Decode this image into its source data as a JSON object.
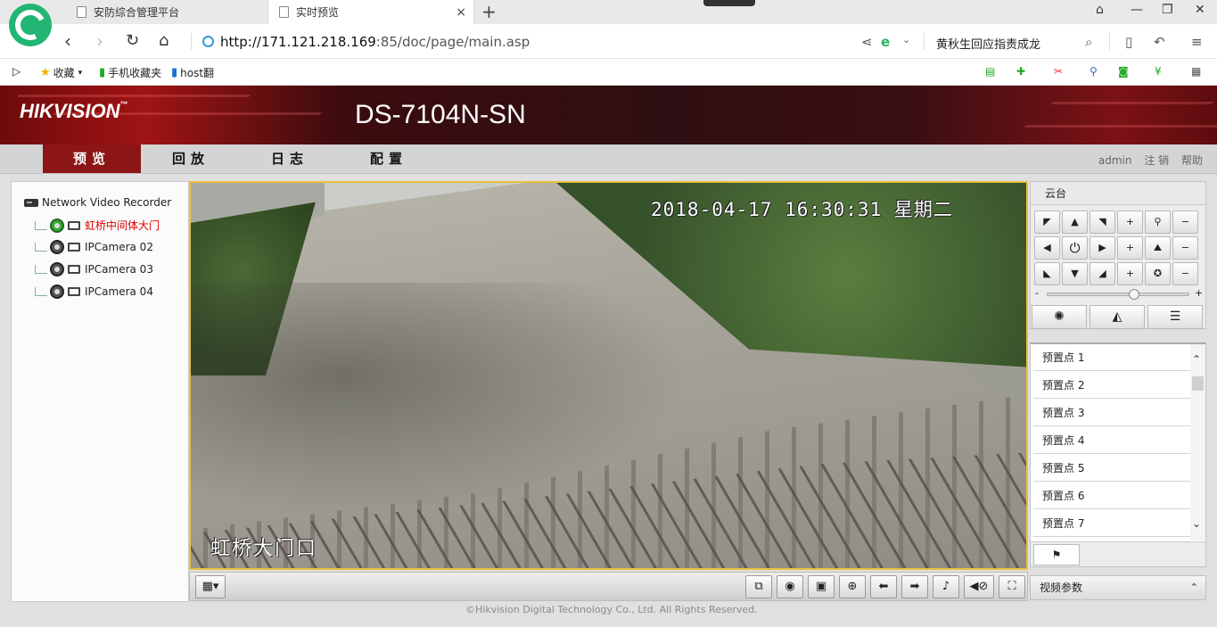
{
  "browser": {
    "tabs": [
      {
        "label": "安防综合管理平台"
      },
      {
        "label": "实时预览",
        "close": "×"
      }
    ],
    "new_tab": "+",
    "url_host": "http://171.121.218.169",
    "url_rest": ":85/doc/page/main.asp",
    "search_text": "黄秋生回应指责成龙",
    "favorites": [
      {
        "label": "收藏",
        "icon": "star-icon"
      },
      {
        "label": "手机收藏夹",
        "icon": "phone-icon"
      },
      {
        "label": "host翻",
        "icon": "bookmark-icon"
      }
    ]
  },
  "header": {
    "logo_text": "HIKVISION",
    "model": "DS-7104N-SN"
  },
  "menu": {
    "items": [
      {
        "label": "预览"
      },
      {
        "label": "回放"
      },
      {
        "label": "日志"
      },
      {
        "label": "配置"
      }
    ],
    "user": "admin",
    "logout": "注 销",
    "help": "帮助"
  },
  "tree": {
    "root": "Network Video Recorder",
    "cameras": [
      {
        "name": "虹桥中间体大门",
        "active": true
      },
      {
        "name": "IPCamera 02",
        "active": false
      },
      {
        "name": "IPCamera 03",
        "active": false
      },
      {
        "name": "IPCamera 04",
        "active": false
      }
    ]
  },
  "video": {
    "osd_time": "2018-04-17 16:30:31 星期二",
    "osd_name": "虹桥大门口"
  },
  "ptz": {
    "title": "云台",
    "presets": [
      "预置点 1",
      "预置点 2",
      "预置点 3",
      "预置点 4",
      "预置点 5",
      "预置点 6",
      "预置点 7"
    ],
    "video_params": "视频参数"
  },
  "footer": {
    "copyright": "©Hikvision Digital Technology Co., Ltd. All Rights Reserved."
  },
  "colors": {
    "menu_active": "#8c1515",
    "active_camera": "#dd0000",
    "video_border": "#e8c23c"
  }
}
